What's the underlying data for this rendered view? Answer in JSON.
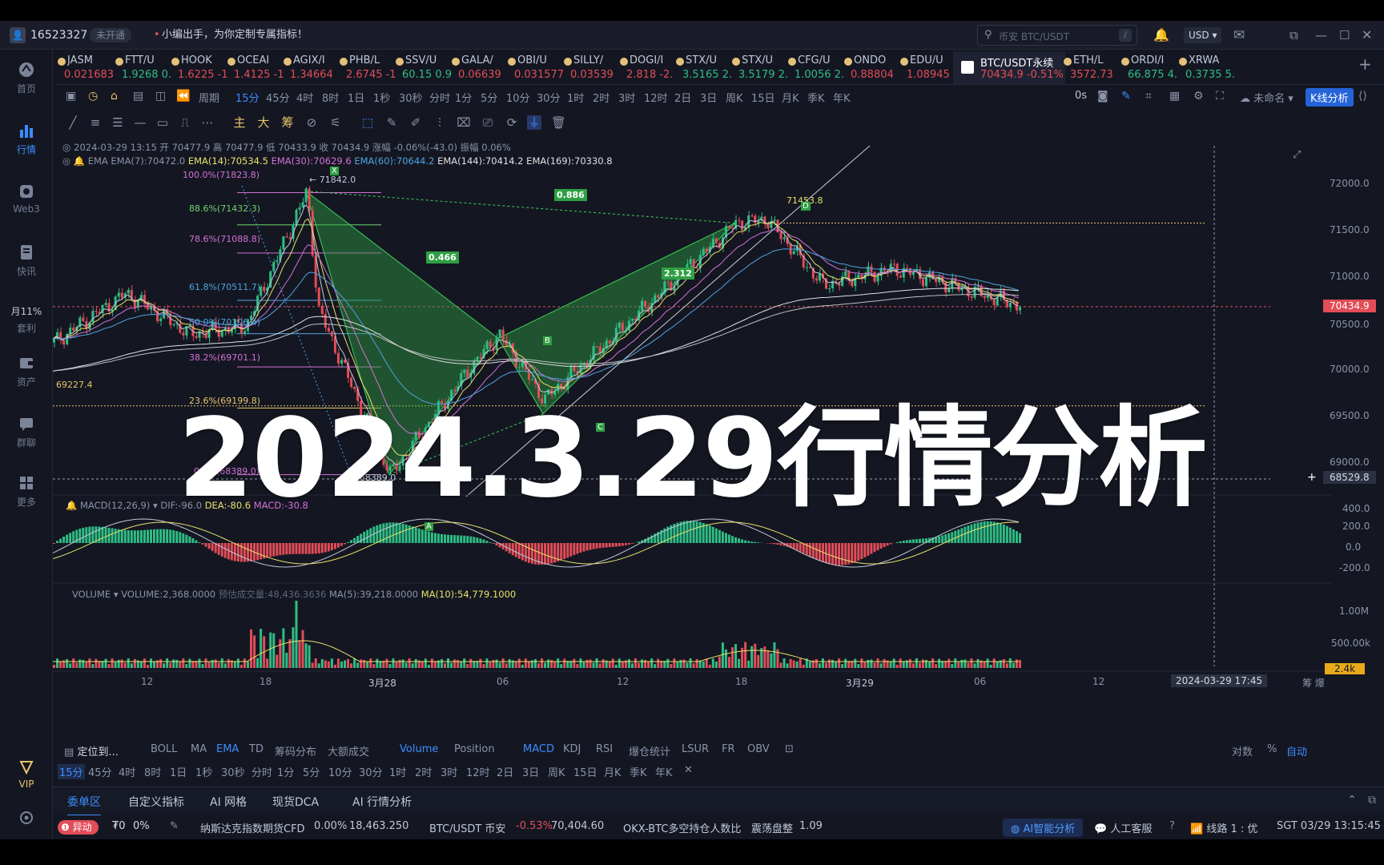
{
  "titlebar": {
    "user_id": "16523327",
    "vip_status": "未开通",
    "notice": "小编出手，为你定制专属指标！",
    "search_placeholder": "币安 BTC/USDT",
    "search_shortcut": "/",
    "currency": "USD"
  },
  "sidebar": {
    "items": [
      {
        "label": "首页",
        "icon": "home-icon"
      },
      {
        "label": "行情",
        "icon": "chart-bars-icon"
      },
      {
        "label": "Web3",
        "icon": "web3-icon"
      },
      {
        "label": "快讯",
        "icon": "news-icon"
      },
      {
        "label": "月11%",
        "sub": "套利",
        "icon": "arbitrage-icon"
      },
      {
        "label": "资产",
        "icon": "wallet-icon"
      },
      {
        "label": "群聊",
        "icon": "chat-icon"
      },
      {
        "label": "更多",
        "icon": "grid-icon"
      },
      {
        "label": "VIP",
        "icon": "vip-icon"
      },
      {
        "label": "",
        "icon": "settings-icon"
      }
    ]
  },
  "tickers": [
    {
      "name": "JASM",
      "price": "0.021683",
      "dir": "down"
    },
    {
      "name": "FTT/U",
      "price": "1.9268 0.",
      "dir": "up"
    },
    {
      "name": "HOOK",
      "price": "1.6225 -1",
      "dir": "down"
    },
    {
      "name": "OCEAI",
      "price": "1.4125 -1",
      "dir": "down"
    },
    {
      "name": "AGIX/I",
      "price": "1.34664",
      "dir": "down"
    },
    {
      "name": "PHB/L",
      "price": "2.6745 -1",
      "dir": "down"
    },
    {
      "name": "SSV/U",
      "price": "60.15 0.9",
      "dir": "up"
    },
    {
      "name": "GALA/",
      "price": "0.06639",
      "dir": "down"
    },
    {
      "name": "OBI/U",
      "price": "0.031577",
      "dir": "down"
    },
    {
      "name": "SILLY/",
      "price": "0.03539",
      "dir": "down"
    },
    {
      "name": "DOGI/I",
      "price": "2.818 -2.",
      "dir": "down"
    },
    {
      "name": "STX/U",
      "price": "3.5165 2.",
      "dir": "up"
    },
    {
      "name": "STX/U",
      "price": "3.5179 2.",
      "dir": "up"
    },
    {
      "name": "CFG/U",
      "price": "1.0056 2.",
      "dir": "up"
    },
    {
      "name": "ONDO",
      "price": "0.88804",
      "dir": "down"
    },
    {
      "name": "EDU/U",
      "price": "1.08945 (",
      "dir": "down"
    },
    {
      "name": "BTC/USDT永续",
      "price": "70434.9 -0.51%",
      "dir": "down",
      "active": true
    },
    {
      "name": "ETH/L",
      "price": "3572.73",
      "dir": "down"
    },
    {
      "name": "ORDI/I",
      "price": "66.875 4.",
      "dir": "up"
    },
    {
      "name": "XRWA",
      "price": "0.3735 5.",
      "dir": "up"
    }
  ],
  "periods": {
    "left": [
      "周期",
      "15分",
      "45分",
      "4时",
      "8时",
      "1日",
      "1秒",
      "30秒",
      "分时",
      "1分",
      "5分",
      "10分",
      "30分",
      "1时",
      "2时",
      "3时",
      "12时",
      "2日",
      "3日",
      "周K",
      "15日",
      "月K",
      "季K",
      "年K"
    ],
    "active": "15分",
    "timer": "0s",
    "layout_name": "未命名",
    "analysis_button": "K线分析"
  },
  "chart_info": {
    "ohlc": "2024-03-29 13:15  开 70477.9  高 70477.9  低 70433.9  收 70434.9  涨幅 -0.06%(-43.0)  振幅 0.06%",
    "ema_label": "EMA",
    "ema_values": [
      "EMA(7):70472.0",
      "EMA(14):70534.5",
      "EMA(30):70629.6",
      "EMA(60):70644.2",
      "EMA(144):70414.2",
      "EMA(169):70330.8"
    ],
    "fib_levels": [
      "100.0%(71823.8)",
      "88.6%(71432.3)",
      "78.6%(71088.8)",
      "61.8%(70511.7)",
      "50.0%(70106.4)",
      "38.2%(69701.1)",
      "23.6%(69199.8)",
      "0.0%(68389.0)"
    ],
    "pattern_labels": {
      "X": "X",
      "A": "A",
      "B": "B",
      "C": "C",
      "D": "D",
      "xb": "0.886",
      "ab": "0.466",
      "bc": "2.312"
    },
    "annotations": {
      "high": "71842.0",
      "d_price": "71453.8",
      "low": "68389.0",
      "left_level": "69227.4"
    },
    "price_axis": [
      "72000.0",
      "71500.0",
      "71000.0",
      "70500.0",
      "70000.0",
      "69500.0",
      "69000.0"
    ],
    "current_price": "70434.9",
    "crosshair_price": "68529.8",
    "macd_label": "MACD(12,26,9)",
    "macd_values": [
      "DIF:-96.0",
      "DEA:-80.6",
      "MACD:-30.8"
    ],
    "macd_axis": [
      "400.0",
      "200.0",
      "0.0",
      "-200.0"
    ],
    "volume_label": "VOLUME",
    "volume_values": [
      "VOLUME:2,368.0000",
      "预估成交量:48,436.3636",
      "MA(5):39,218.0000",
      "MA(10):54,779.1000"
    ],
    "volume_axis": [
      "1.00M",
      "500.00k",
      "2.4k"
    ],
    "time_axis": [
      "12",
      "18",
      "3月28",
      "06",
      "12",
      "18",
      "3月29",
      "06",
      "12"
    ],
    "crosshair_time": "2024-03-29 17:45",
    "axis_options": [
      "筹",
      "爆"
    ]
  },
  "chart_data": {
    "type": "candlestick",
    "series": [
      {
        "name": "BTC/USDT永续 15分",
        "points": [
          {
            "x": "2024-03-27 10:00",
            "y": 70000
          },
          {
            "x": "2024-03-27 14:00",
            "y": 70600
          },
          {
            "x": "2024-03-27 20:00",
            "y": 70100
          },
          {
            "x": "2024-03-28 00:00",
            "y": 70200
          },
          {
            "x": "2024-03-28 02:15",
            "y": 71842
          },
          {
            "x": "2024-03-28 03:00",
            "y": 70400
          },
          {
            "x": "2024-03-28 05:30",
            "y": 68389
          },
          {
            "x": "2024-03-28 09:00",
            "y": 69700
          },
          {
            "x": "2024-03-28 10:30",
            "y": 70100
          },
          {
            "x": "2024-03-28 13:00",
            "y": 69300
          },
          {
            "x": "2024-03-28 22:30",
            "y": 71453.8
          },
          {
            "x": "2024-03-29 00:00",
            "y": 71500
          },
          {
            "x": "2024-03-29 06:00",
            "y": 70700
          },
          {
            "x": "2024-03-29 09:00",
            "y": 70900
          },
          {
            "x": "2024-03-29 13:15",
            "y": 70434.9
          }
        ]
      }
    ],
    "ylim": [
      68200,
      72200
    ]
  },
  "overlay_title": "2024.3.29行情分析",
  "indicators_row": {
    "locate": "定位到...",
    "items": [
      "BOLL",
      "MA",
      "EMA",
      "TD",
      "筹码分布",
      "大额成交",
      "Volume",
      "Position",
      "MACD",
      "KDJ",
      "RSI",
      "爆仓统计",
      "LSUR",
      "FR",
      "OBV"
    ],
    "active": [
      "EMA",
      "Volume",
      "MACD"
    ],
    "right": [
      "对数",
      "%",
      "自动"
    ]
  },
  "periods2": [
    "15分",
    "45分",
    "4时",
    "8时",
    "1日",
    "1秒",
    "30秒",
    "分时",
    "1分",
    "5分",
    "10分",
    "30分",
    "1时",
    "2时",
    "3时",
    "12时",
    "2日",
    "3日",
    "周K",
    "15日",
    "月K",
    "季K",
    "年K"
  ],
  "tabs": [
    "委单区",
    "自定义指标",
    "AI 网格",
    "现货DCA",
    "AI 行情分析"
  ],
  "status": {
    "alert": "异动",
    "balance": "₮0",
    "pct": "0%",
    "items": [
      "纳斯达克指数期货CFD",
      "0.00%",
      "18,463.250",
      "BTC/USDT 币安",
      "-0.53%",
      "70,404.60",
      "OKX-BTC多空持仓人数比",
      "震荡盘整",
      "1.09"
    ],
    "ai": "AI智能分析",
    "service": "人工客服",
    "line": "线路 1 : 优",
    "time": "SGT 03/29 13:15:45"
  }
}
